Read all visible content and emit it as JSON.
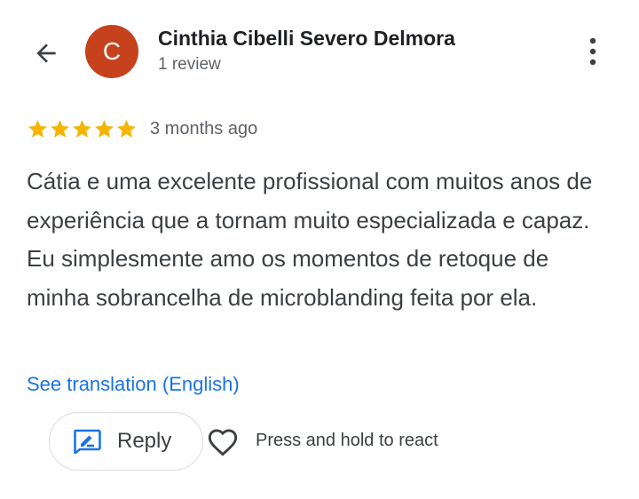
{
  "header": {
    "avatar_letter": "C",
    "avatar_color": "#c5421d",
    "author_name": "Cinthia Cibelli Severo Delmora",
    "review_count": "1 review",
    "back_icon": "arrow-left-icon",
    "more_icon": "more-vert-icon"
  },
  "review": {
    "rating": 5,
    "rating_max": 5,
    "star_color": "#f4b400",
    "time_ago": "3 months ago",
    "text": "Cátia e uma excelente profissional com muitos anos de experiência que a tornam muito especializada e capaz. Eu simplesmente amo os momentos de retoque de minha sobrancelha de microblanding feita por ela.",
    "translate_link": "See translation (English)"
  },
  "actions": {
    "reply_label": "Reply",
    "reply_icon": "rate-review-icon",
    "react_icon": "heart-outline-icon",
    "react_hint": "Press and hold to react"
  },
  "colors": {
    "link": "#1a73e8",
    "secondary_text": "#5f6368"
  }
}
